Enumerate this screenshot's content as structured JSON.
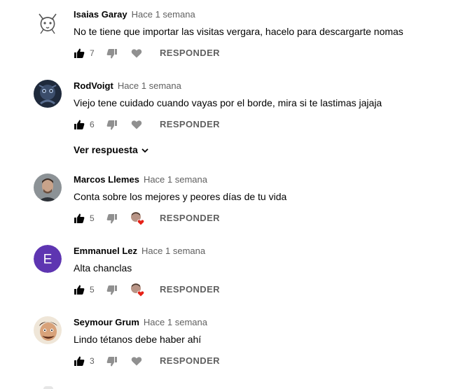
{
  "comments": [
    {
      "author": "Isaias Garay",
      "time": "Hace 1 semana",
      "text": "No te tiene que importar las visitas vergara, hacelo para descargarte nomas",
      "likes": "7",
      "reply": "RESPONDER",
      "avatar": "cat-sketch",
      "creator_heart": false
    },
    {
      "author": "RodVoigt",
      "time": "Hace 1 semana",
      "text": "Viejo tene cuidado cuando vayas por el borde, mira si te lastimas jajaja",
      "likes": "6",
      "reply": "RESPONDER",
      "avatar": "dark-creature",
      "creator_heart": false
    },
    {
      "author": "Marcos Llemes",
      "time": "Hace 1 semana",
      "text": "Conta sobre los mejores y peores días de tu vida",
      "likes": "5",
      "reply": "RESPONDER",
      "avatar": "photo-man",
      "creator_heart": true
    },
    {
      "author": "Emmanuel Lez",
      "time": "Hace 1 semana",
      "text": "Alta chanclas",
      "likes": "5",
      "reply": "RESPONDER",
      "avatar_letter": "E",
      "avatar_color": "#5e35b1",
      "creator_heart": true
    },
    {
      "author": "Seymour Grum",
      "time": "Hace 1 semana",
      "text": "Lindo tétanos debe haber ahí",
      "likes": "3",
      "reply": "RESPONDER",
      "avatar": "cartoon-face",
      "creator_heart": false
    }
  ],
  "view_replies": "Ver respuesta",
  "colors": {
    "heart": "#e62117",
    "icon": "#909090",
    "text": "#030303",
    "meta": "#606060"
  }
}
